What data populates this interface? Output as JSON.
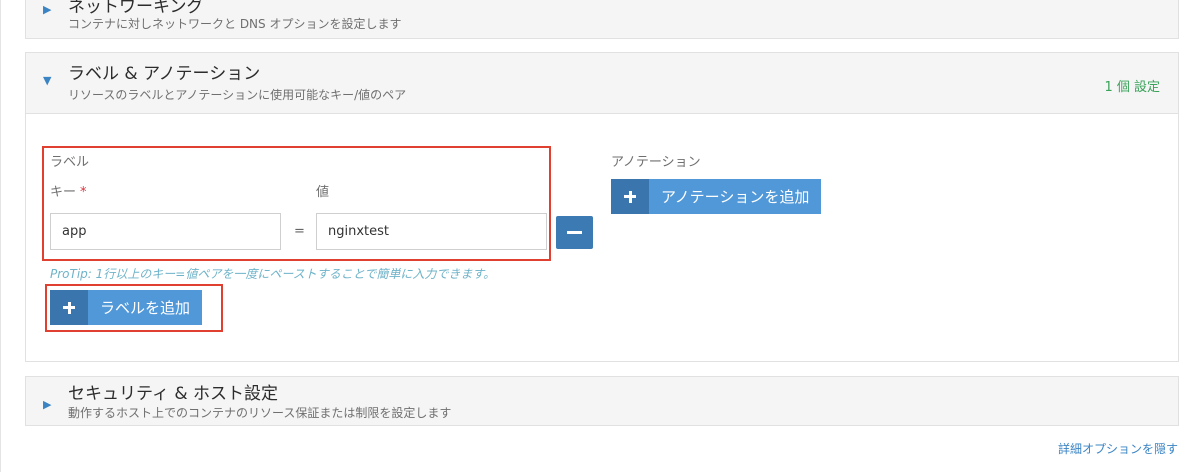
{
  "sections": {
    "network": {
      "title": "ネットワーキング",
      "subtitle": "コンテナに対しネットワークと DNS オプションを設定します"
    },
    "labels": {
      "title": "ラベル & アノテーション",
      "subtitle": "リソースのラベルとアノテーションに使用可能なキー/値のペア",
      "count_badge": "1 個 設定"
    },
    "security": {
      "title": "セキュリティ & ホスト設定",
      "subtitle": "動作するホスト上でのコンテナのリソース保証または制限を設定します"
    }
  },
  "labels_panel": {
    "heading": "ラベル",
    "key_header": "キー",
    "required_mark": "*",
    "value_header": "値",
    "rows": [
      {
        "key": "app",
        "separator": "=",
        "value": "nginxtest"
      }
    ],
    "protip": "ProTip: 1行以上のキー=値ペアを一度にペーストすることで簡単に入力できます。",
    "add_button": "ラベルを追加"
  },
  "annotations_panel": {
    "heading": "アノテーション",
    "add_button": "アノテーションを追加"
  },
  "footer": {
    "hide_advanced": "詳細オプションを隠す"
  },
  "colors": {
    "accent": "#3a84c4",
    "button_dark": "#3a76ad",
    "button_light": "#5198d9",
    "highlight": "#e0402f",
    "badge": "#3aa35a",
    "protip": "#6fb3c9"
  },
  "icons": {
    "expand": "caret-right-icon",
    "collapse": "caret-down-icon",
    "plus": "plus-icon",
    "minus": "minus-icon"
  }
}
